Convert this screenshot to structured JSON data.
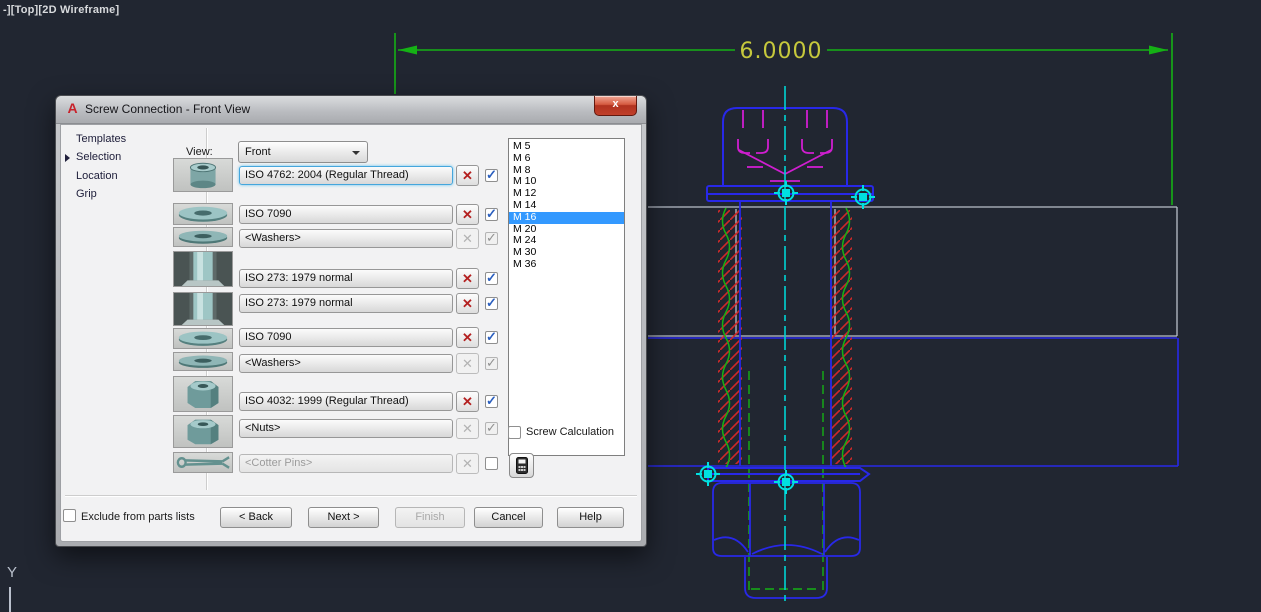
{
  "viewport_label": "-][Top][2D Wireframe]",
  "ucs": {
    "y_axis_label": "Y"
  },
  "dialog": {
    "app_icon_letter": "A",
    "title": "Screw Connection - Front View",
    "close_glyph": "x",
    "nav": {
      "items": [
        {
          "label": "Templates",
          "active": false
        },
        {
          "label": "Selection",
          "active": true
        },
        {
          "label": "Location",
          "active": false
        },
        {
          "label": "Grip",
          "active": false
        }
      ]
    },
    "view": {
      "label": "View:",
      "value": "Front"
    },
    "rows": [
      {
        "thumb": "socket-head-cap-screw",
        "value": "ISO 4762: 2004 (Regular Thread)",
        "focused": true,
        "remove": "enabled",
        "checkbox": "checked"
      },
      {
        "thumb": "washer",
        "value": "ISO 7090",
        "focused": false,
        "remove": "enabled",
        "checkbox": "checked"
      },
      {
        "thumb": "washer",
        "value": "<Washers>",
        "focused": false,
        "remove": "disabled",
        "checkbox": "checked-disabled"
      },
      {
        "thumb": "tapped-hole",
        "value": "ISO 273: 1979 normal",
        "focused": false,
        "remove": "enabled",
        "checkbox": "checked"
      },
      {
        "thumb": "tapped-hole",
        "value": "ISO 273: 1979 normal",
        "focused": false,
        "remove": "enabled",
        "checkbox": "checked"
      },
      {
        "thumb": "washer",
        "value": "ISO 7090",
        "focused": false,
        "remove": "enabled",
        "checkbox": "checked"
      },
      {
        "thumb": "washer",
        "value": "<Washers>",
        "focused": false,
        "remove": "disabled",
        "checkbox": "checked-disabled"
      },
      {
        "thumb": "hex-nut",
        "value": "ISO 4032: 1999 (Regular Thread)",
        "focused": false,
        "remove": "enabled",
        "checkbox": "checked"
      },
      {
        "thumb": "hex-nut",
        "value": "<Nuts>",
        "focused": false,
        "remove": "disabled",
        "checkbox": "checked-disabled"
      },
      {
        "thumb": "cotter-pin",
        "value": "<Cotter Pins>",
        "focused": false,
        "remove": "disabled",
        "checkbox": "unchecked"
      }
    ],
    "sizes": {
      "items": [
        "M 5",
        "M 6",
        "M 8",
        "M 10",
        "M 12",
        "M 14",
        "M 16",
        "M 20",
        "M 24",
        "M 30",
        "M 36"
      ],
      "selected": "M 16"
    },
    "screw_calculation_label": "Screw Calculation",
    "exclude_label": "Exclude from parts lists",
    "buttons": {
      "back": "< Back",
      "next": "Next >",
      "finish": "Finish",
      "cancel": "Cancel",
      "help": "Help"
    }
  },
  "drawing": {
    "dimension_value": "6.0000",
    "colors": {
      "background": "#212631",
      "cad_blue": "#2828e8",
      "cad_green": "#15b115",
      "cad_cyan": "#00d2d2",
      "cad_magenta": "#d01ed0",
      "cad_red": "#d02828",
      "plate_gray": "#b9bfca",
      "dimension_text": "#c6c83c",
      "selection_highlight": "#3399ff"
    }
  }
}
